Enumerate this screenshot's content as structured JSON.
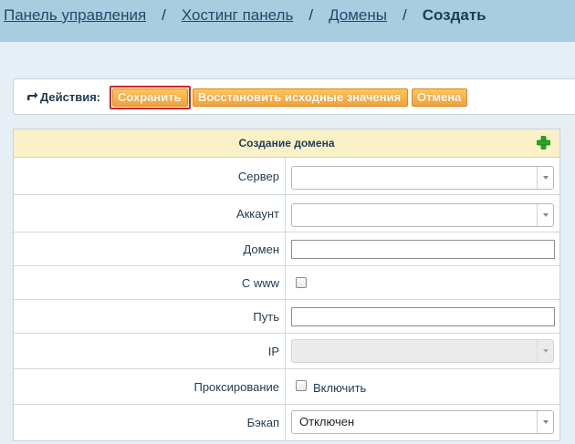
{
  "breadcrumb": {
    "items": [
      "Панель управления",
      "Хостинг панель",
      "Домены"
    ],
    "separator": "/",
    "current": "Создать"
  },
  "actions": {
    "label": "Действия:",
    "arrow_icon": "share-arrow-icon",
    "save": "Сохранить",
    "restore": "Восстановить исходные значения",
    "cancel": "Отмена"
  },
  "form": {
    "title": "Создание домена",
    "add_icon": "plus-icon",
    "fields": {
      "server": {
        "label": "Сервер",
        "value": ""
      },
      "account": {
        "label": "Аккаунт",
        "value": ""
      },
      "domain": {
        "label": "Домен",
        "value": ""
      },
      "www": {
        "label": "С www",
        "checked": false
      },
      "path": {
        "label": "Путь",
        "value": ""
      },
      "ip": {
        "label": "IP",
        "value": "",
        "disabled": true
      },
      "proxy": {
        "label": "Проксирование",
        "checkbox_label": "Включить",
        "checked": false
      },
      "backup": {
        "label": "Бэкап",
        "value": "Отключен"
      }
    }
  },
  "colors": {
    "topbar": "#a9cde0",
    "page_bg": "#e6eef6",
    "button_orange": "#f4a23a",
    "header_bg": "#fbf1c8",
    "focus_red": "#c8252c",
    "plus_green": "#2aa520"
  }
}
